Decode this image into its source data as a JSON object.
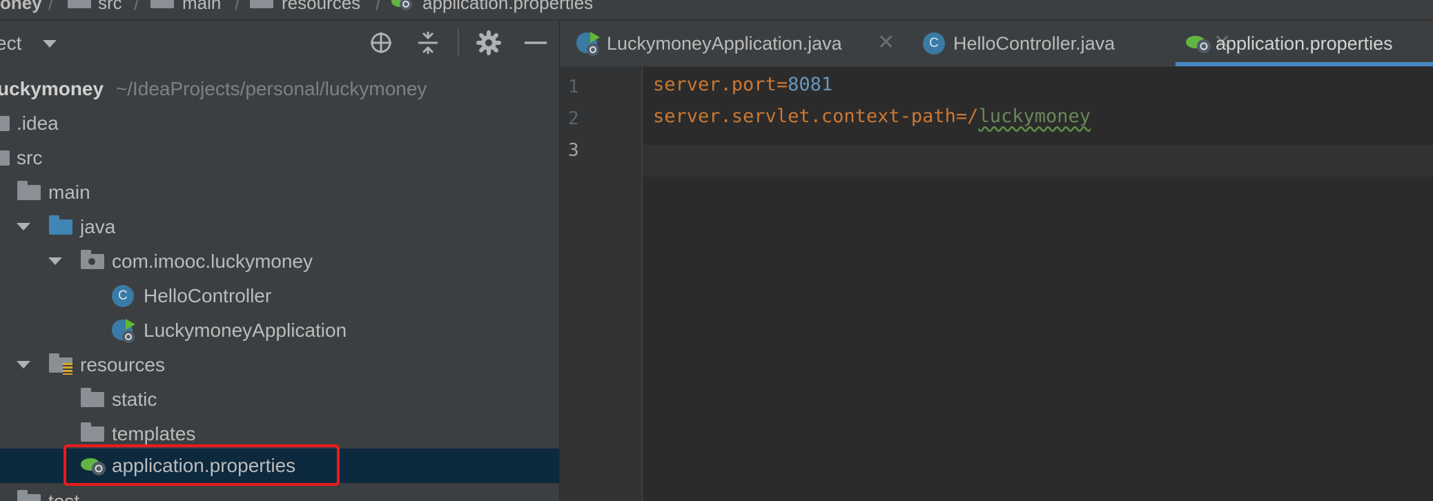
{
  "breadcrumb": {
    "items": [
      "oney",
      "src",
      "main",
      "resources",
      "application.properties"
    ]
  },
  "project_panel": {
    "title": "ect",
    "tree": [
      {
        "label": "uckymoney",
        "path": "~/IdeaProjects/personal/luckymoney"
      },
      {
        "label": ".idea"
      },
      {
        "label": "src"
      },
      {
        "label": "main"
      },
      {
        "label": "java"
      },
      {
        "label": "com.imooc.luckymoney"
      },
      {
        "label": "HelloController"
      },
      {
        "label": "LuckymoneyApplication"
      },
      {
        "label": "resources"
      },
      {
        "label": "static"
      },
      {
        "label": "templates"
      },
      {
        "label": "application.properties"
      },
      {
        "label": "test"
      }
    ]
  },
  "editor": {
    "tabs": [
      {
        "label": "LuckymoneyApplication.java",
        "close": "✕"
      },
      {
        "label": "HelloController.java",
        "close": "✕"
      },
      {
        "label": "application.properties"
      }
    ],
    "line_numbers": [
      "1",
      "2",
      "3"
    ],
    "lines": [
      {
        "key": "server.port",
        "sep": "=",
        "value": "8081"
      },
      {
        "key": "server.servlet.context-path",
        "sep": "=",
        "value_prefix": "/",
        "value": "luckymoney"
      }
    ]
  },
  "icons": {
    "locate": "crosshair-icon",
    "collapse": "collapse-all-icon",
    "settings": "gear-icon",
    "hide": "minimize-icon",
    "class": "class-icon",
    "spring_boot": "spring-boot-icon",
    "folder": "folder-icon"
  },
  "colors": {
    "selection": "#0d293e",
    "highlight_box": "#ee1b1b",
    "keyword": "#cc7832",
    "number": "#6897bb",
    "active_tab_underline": "#4a88c7"
  }
}
